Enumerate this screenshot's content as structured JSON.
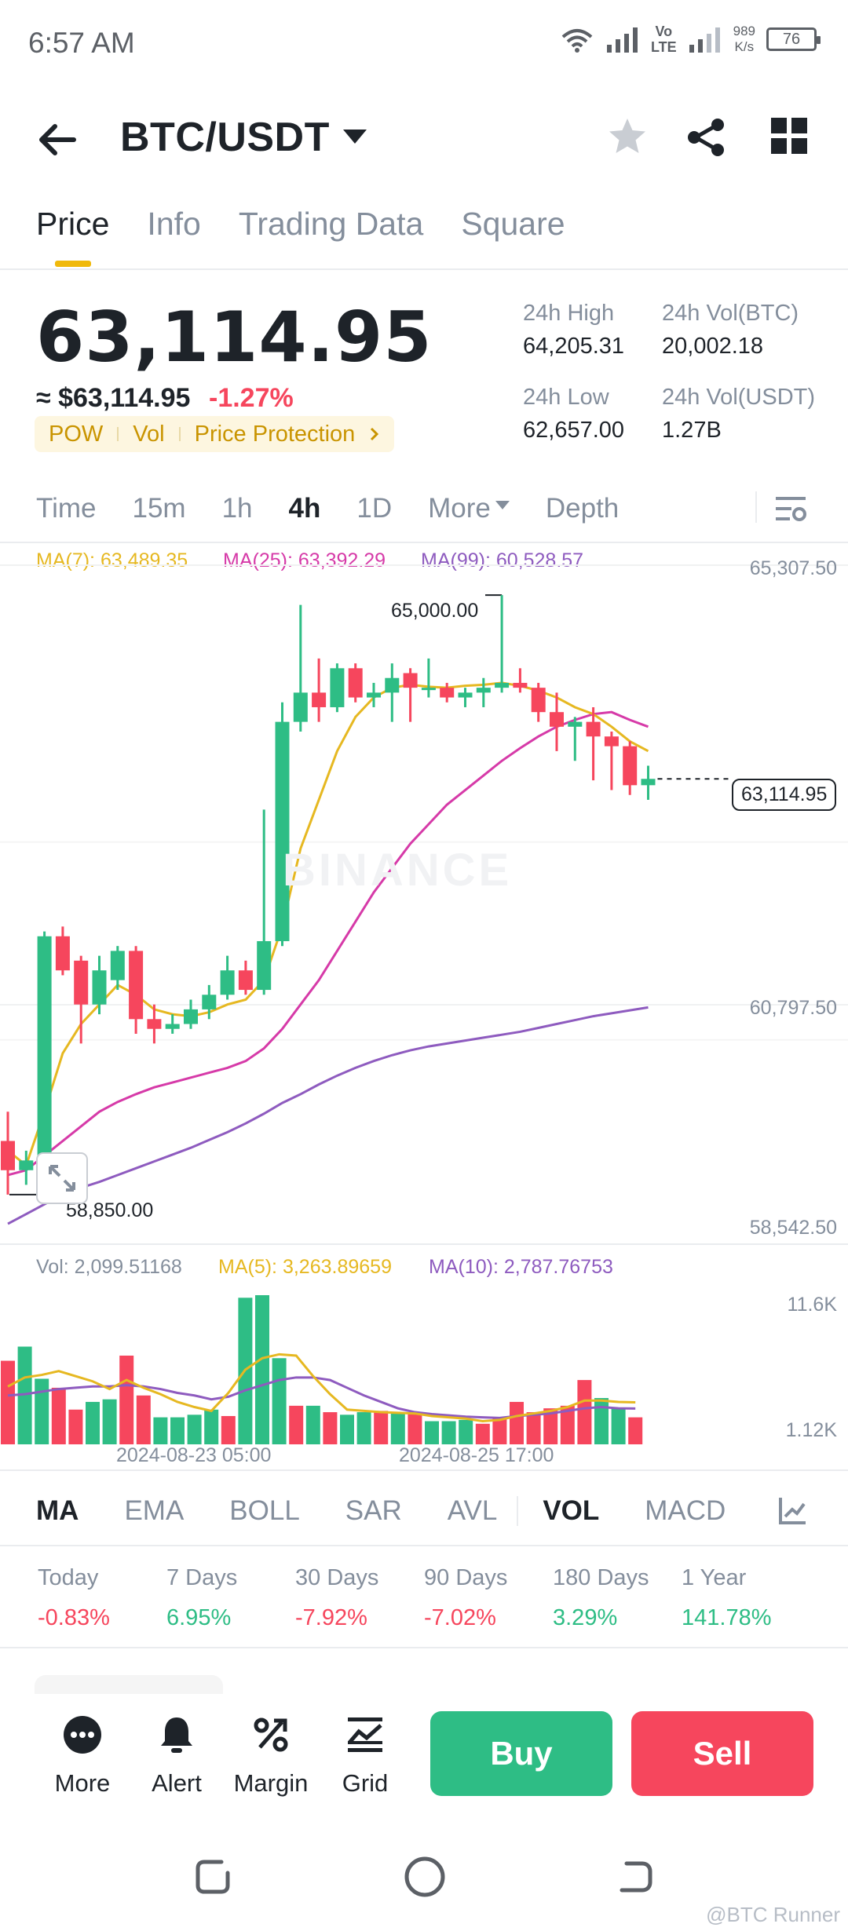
{
  "status_bar": {
    "time": "6:57 AM",
    "network_lines": [
      "Vo",
      "LTE"
    ],
    "speed_value": "989",
    "speed_unit": "K/s",
    "battery": "76"
  },
  "header": {
    "title": "BTC/USDT",
    "icons": [
      "back-arrow-icon",
      "chevron-down-icon",
      "star-icon",
      "share-icon",
      "grid-icon"
    ]
  },
  "tabs": [
    {
      "label": "Price",
      "active": true
    },
    {
      "label": "Info",
      "active": false
    },
    {
      "label": "Trading Data",
      "active": false
    },
    {
      "label": "Square",
      "active": false
    }
  ],
  "price": {
    "last": "63,114.95",
    "usd": "≈ $63,114.95",
    "change_pct": "-1.27%",
    "tags": [
      "POW",
      "Vol",
      "Price Protection"
    ],
    "stats": {
      "high_label": "24h High",
      "high_value": "64,205.31",
      "vol_btc_label": "24h Vol(BTC)",
      "vol_btc_value": "20,002.18",
      "low_label": "24h Low",
      "low_value": "62,657.00",
      "vol_usdt_label": "24h Vol(USDT)",
      "vol_usdt_value": "1.27B"
    }
  },
  "intervals": {
    "items": [
      "Time",
      "15m",
      "1h",
      "4h",
      "1D"
    ],
    "active": "4h",
    "more": "More",
    "depth": "Depth"
  },
  "chart": {
    "ma7": "MA(7): 63,489.35",
    "ma25": "MA(25): 63,392.29",
    "ma99": "MA(99): 60,528.57",
    "y_top": "65,307.50",
    "y_mid": "60,797.50",
    "y_bottom": "58,542.50",
    "high_marker": "65,000.00",
    "low_marker": "58,850.00",
    "current_label": "63,114.95",
    "watermark": "BINANCE",
    "vol_text": "Vol: 2,099.51168",
    "vol_ma5": "MA(5): 3,263.89659",
    "vol_ma10": "MA(10): 2,787.76753",
    "vol_top": "11.6K",
    "vol_bottom": "1.12K",
    "date_left": "2024-08-23 05:00",
    "date_right": "2024-08-25 17:00",
    "colors": {
      "up": "#2ebd85",
      "down": "#f6465d",
      "ma7": "#e6b821",
      "ma25": "#d63aa8",
      "ma99": "#8e5bbf"
    }
  },
  "chart_data": {
    "type": "candlestick",
    "ylim": [
      58542.5,
      65307.5
    ],
    "candles": [
      {
        "o": 59400,
        "h": 59700,
        "l": 58850,
        "c": 59100
      },
      {
        "o": 59100,
        "h": 59300,
        "l": 58950,
        "c": 59200
      },
      {
        "o": 59200,
        "h": 61550,
        "l": 59100,
        "c": 61500
      },
      {
        "o": 61500,
        "h": 61600,
        "l": 61100,
        "c": 61150
      },
      {
        "o": 61250,
        "h": 61300,
        "l": 60400,
        "c": 60800
      },
      {
        "o": 60800,
        "h": 61300,
        "l": 60700,
        "c": 61150
      },
      {
        "o": 61050,
        "h": 61400,
        "l": 60950,
        "c": 61350
      },
      {
        "o": 61350,
        "h": 61400,
        "l": 60500,
        "c": 60650
      },
      {
        "o": 60650,
        "h": 60800,
        "l": 60400,
        "c": 60550
      },
      {
        "o": 60550,
        "h": 60700,
        "l": 60500,
        "c": 60600
      },
      {
        "o": 60600,
        "h": 60850,
        "l": 60550,
        "c": 60750
      },
      {
        "o": 60750,
        "h": 61000,
        "l": 60650,
        "c": 60900
      },
      {
        "o": 60900,
        "h": 61300,
        "l": 60850,
        "c": 61150
      },
      {
        "o": 61150,
        "h": 61250,
        "l": 60900,
        "c": 60950
      },
      {
        "o": 60950,
        "h": 62800,
        "l": 60900,
        "c": 61450
      },
      {
        "o": 61450,
        "h": 63900,
        "l": 61400,
        "c": 63700
      },
      {
        "o": 63700,
        "h": 64900,
        "l": 63600,
        "c": 64000
      },
      {
        "o": 64000,
        "h": 64350,
        "l": 63700,
        "c": 63850
      },
      {
        "o": 63850,
        "h": 64300,
        "l": 63800,
        "c": 64250
      },
      {
        "o": 64250,
        "h": 64300,
        "l": 63900,
        "c": 63950
      },
      {
        "o": 63950,
        "h": 64100,
        "l": 63850,
        "c": 64000
      },
      {
        "o": 64000,
        "h": 64300,
        "l": 63700,
        "c": 64150
      },
      {
        "o": 64200,
        "h": 64250,
        "l": 63700,
        "c": 64050
      },
      {
        "o": 64050,
        "h": 64350,
        "l": 63950,
        "c": 64050
      },
      {
        "o": 64050,
        "h": 64100,
        "l": 63900,
        "c": 63950
      },
      {
        "o": 63950,
        "h": 64050,
        "l": 63850,
        "c": 64000
      },
      {
        "o": 64000,
        "h": 64150,
        "l": 63850,
        "c": 64050
      },
      {
        "o": 64050,
        "h": 65000,
        "l": 64000,
        "c": 64100
      },
      {
        "o": 64100,
        "h": 64250,
        "l": 64000,
        "c": 64050
      },
      {
        "o": 64050,
        "h": 64100,
        "l": 63700,
        "c": 63800
      },
      {
        "o": 63800,
        "h": 64000,
        "l": 63400,
        "c": 63650
      },
      {
        "o": 63650,
        "h": 63750,
        "l": 63300,
        "c": 63700
      },
      {
        "o": 63700,
        "h": 63850,
        "l": 63100,
        "c": 63550
      },
      {
        "o": 63550,
        "h": 63600,
        "l": 63000,
        "c": 63450
      },
      {
        "o": 63450,
        "h": 63500,
        "l": 62950,
        "c": 63050
      },
      {
        "o": 63050,
        "h": 63250,
        "l": 62900,
        "c": 63114.95
      }
    ],
    "ma7": [
      59300,
      59150,
      59700,
      60300,
      60600,
      60800,
      61000,
      60900,
      60750,
      60700,
      60680,
      60720,
      60800,
      60850,
      61050,
      61600,
      62400,
      62900,
      63400,
      63750,
      63950,
      64050,
      64080,
      64060,
      64050,
      64070,
      64080,
      64100,
      64070,
      64020,
      63950,
      63850,
      63780,
      63650,
      63500,
      63400
    ],
    "ma25": [
      59050,
      59100,
      59250,
      59400,
      59550,
      59700,
      59800,
      59880,
      59950,
      60000,
      60050,
      60100,
      60150,
      60220,
      60350,
      60550,
      60800,
      61050,
      61350,
      61650,
      61950,
      62200,
      62450,
      62650,
      62850,
      63000,
      63150,
      63300,
      63430,
      63550,
      63650,
      63720,
      63780,
      63800,
      63720,
      63650
    ],
    "ma99": [
      58550,
      58650,
      58750,
      58850,
      58920,
      58980,
      59050,
      59120,
      59190,
      59260,
      59330,
      59410,
      59490,
      59580,
      59680,
      59790,
      59880,
      59980,
      60070,
      60150,
      60220,
      60280,
      60330,
      60370,
      60400,
      60430,
      60460,
      60490,
      60520,
      60560,
      60600,
      60640,
      60680,
      60710,
      60740,
      60770
    ],
    "volume": {
      "ylim": [
        0,
        11600
      ],
      "values": [
        6500,
        7600,
        5100,
        4400,
        2700,
        3300,
        3500,
        6900,
        3800,
        2100,
        2100,
        2300,
        2700,
        2200,
        11400,
        11600,
        6700,
        3000,
        3000,
        2500,
        2300,
        2500,
        2600,
        2500,
        2500,
        1800,
        1800,
        1900,
        1600,
        2000,
        3300,
        2500,
        2800,
        3000,
        5000,
        3600,
        2800,
        2099.51
      ],
      "ma5": [
        4500,
        5200,
        5400,
        5700,
        5300,
        4900,
        4300,
        5000,
        4400,
        3900,
        3300,
        2900,
        2600,
        4000,
        5800,
        6700,
        7000,
        6900,
        5300,
        3900,
        2700,
        2600,
        2500,
        2450,
        2400,
        2200,
        2100,
        2000,
        1800,
        1900,
        2200,
        2400,
        2600,
        2900,
        3400,
        3400,
        3300,
        3263.9
      ],
      "ma10": [
        3800,
        3900,
        4100,
        4300,
        4400,
        4500,
        4500,
        4600,
        4500,
        4300,
        4000,
        3800,
        3500,
        3700,
        4200,
        4600,
        5000,
        5200,
        5200,
        5000,
        4400,
        3800,
        3300,
        2800,
        2500,
        2350,
        2250,
        2150,
        2100,
        2050,
        2200,
        2300,
        2400,
        2600,
        2800,
        2900,
        2800,
        2787.8
      ]
    }
  },
  "indicators": {
    "items": [
      "MA",
      "EMA",
      "BOLL",
      "SAR",
      "AVL",
      "VOL",
      "MACD"
    ],
    "active": [
      "MA",
      "VOL"
    ]
  },
  "performance": [
    {
      "label": "Today",
      "value": "-0.83%",
      "dir": "down"
    },
    {
      "label": "7 Days",
      "value": "6.95%",
      "dir": "up"
    },
    {
      "label": "30 Days",
      "value": "-7.92%",
      "dir": "down"
    },
    {
      "label": "90 Days",
      "value": "-7.02%",
      "dir": "down"
    },
    {
      "label": "180 Days",
      "value": "3.29%",
      "dir": "up"
    },
    {
      "label": "1 Year",
      "value": "141.78%",
      "dir": "up"
    }
  ],
  "bottom_bar": {
    "more": "More",
    "alert": "Alert",
    "margin": "Margin",
    "grid": "Grid",
    "buy": "Buy",
    "sell": "Sell"
  },
  "footer": {
    "credit": "@BTC Runner"
  }
}
